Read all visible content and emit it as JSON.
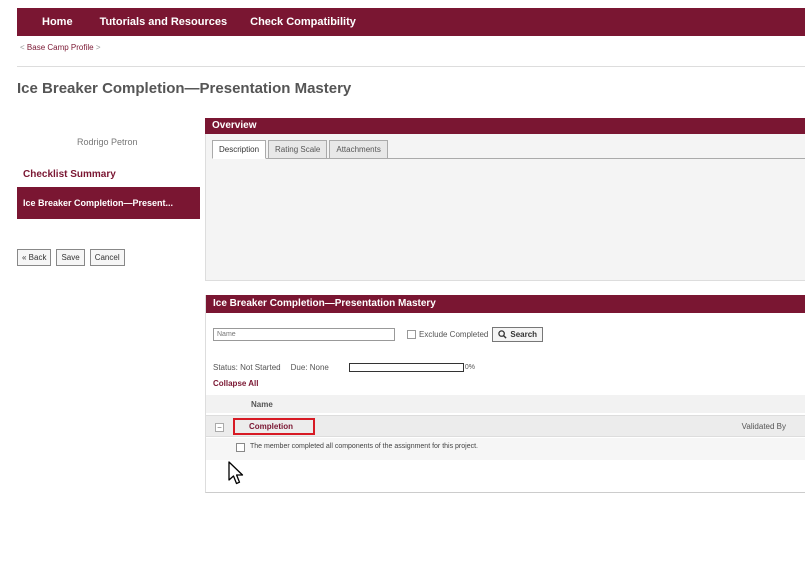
{
  "topnav": {
    "items": [
      "Home",
      "Tutorials and Resources",
      "Check Compatibility"
    ]
  },
  "breadcrumb": {
    "prefix": "<",
    "link": "Base Camp Profile",
    "suffix": ">"
  },
  "page_title": "Ice Breaker Completion—Presentation Mastery",
  "left_panel": {
    "user_name": "Rodrigo Petron",
    "checklist_summary": "Checklist Summary",
    "active_item": "Ice Breaker Completion—Present...",
    "buttons": {
      "back": "« Back",
      "save": "Save",
      "cancel": "Cancel"
    }
  },
  "overview": {
    "header": "Overview",
    "tabs": [
      "Description",
      "Rating Scale",
      "Attachments"
    ]
  },
  "detail": {
    "header": "Ice Breaker Completion—Presentation Mastery",
    "search_placeholder": "Name",
    "exclude_completed": "Exclude Completed",
    "search_button": "Search",
    "status": "Status: Not Started",
    "due": "Due: None",
    "progress": 0,
    "progress_text": "0%",
    "collapse_all": "Collapse All",
    "column_name": "Name",
    "row": {
      "name": "Completion",
      "validated_by": "Validated By",
      "item_text": "The member completed all components of the assignment for this project."
    }
  },
  "colors": {
    "brand": "#7a1632",
    "highlight": "#d71a24"
  }
}
